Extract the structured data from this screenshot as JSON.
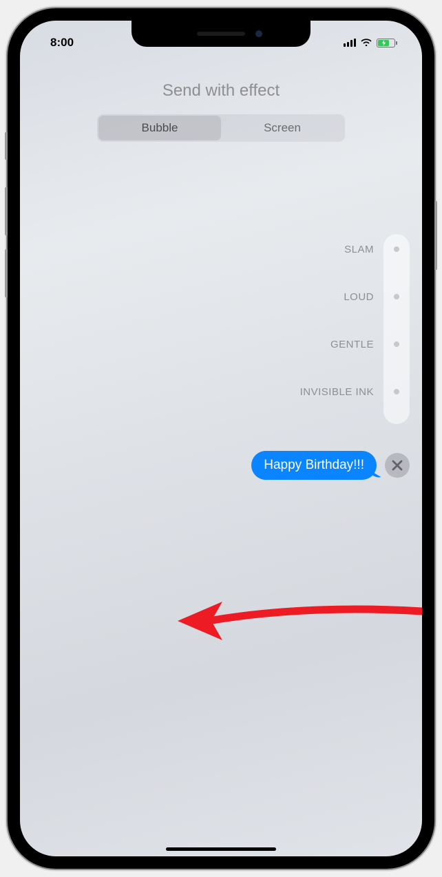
{
  "status": {
    "time": "8:00"
  },
  "header": {
    "title": "Send with effect"
  },
  "tabs": {
    "bubble": "Bubble",
    "screen": "Screen"
  },
  "effects": [
    {
      "label": "SLAM"
    },
    {
      "label": "LOUD"
    },
    {
      "label": "GENTLE"
    },
    {
      "label": "INVISIBLE INK"
    }
  ],
  "message": {
    "text": "Happy Birthday!!!"
  },
  "colors": {
    "accent": "#0a84ff",
    "battery": "#34c759",
    "arrow": "#ed1c24"
  }
}
